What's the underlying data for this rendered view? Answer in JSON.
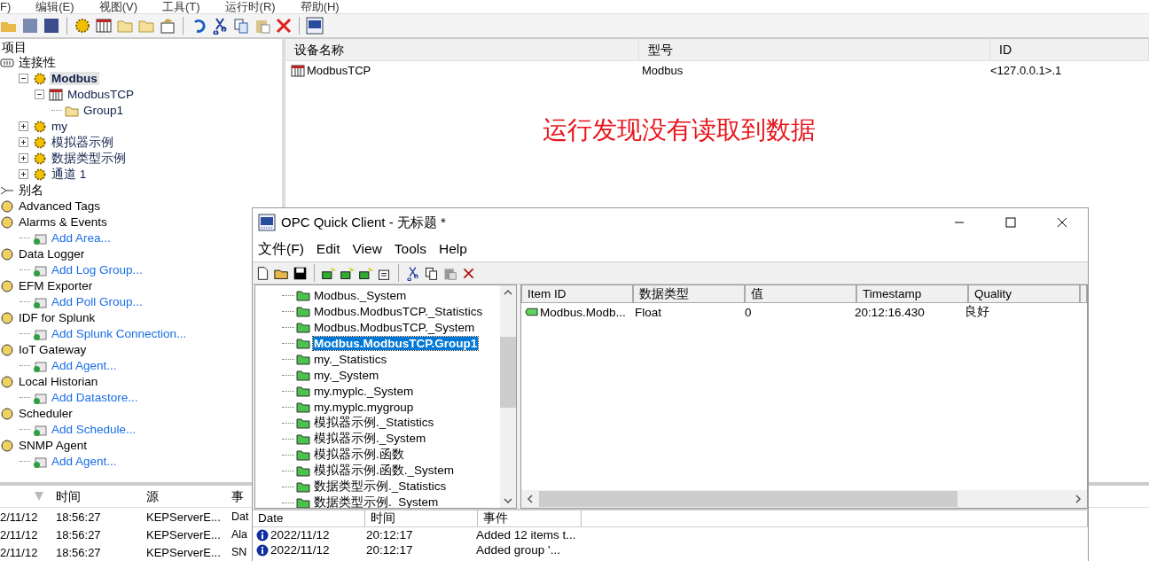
{
  "menu": [
    "F)",
    "编辑(E)",
    "视图(V)",
    "工具(T)",
    "运行时(R)",
    "帮助(H)"
  ],
  "tree_header": "项目",
  "tree": [
    {
      "label": "连接性",
      "kind": "connectivity",
      "children": [
        {
          "label": "Modbus",
          "kind": "channel",
          "selected": true,
          "expanded": true,
          "children": [
            {
              "label": "ModbusTCP",
              "kind": "device",
              "selected": false,
              "expanded": true,
              "children": [
                {
                  "label": "Group1",
                  "kind": "group",
                  "selected": false
                }
              ]
            }
          ]
        },
        {
          "label": "my",
          "kind": "channel",
          "selected": false,
          "expanded": false
        },
        {
          "label": "模拟器示例",
          "kind": "channel",
          "selected": false,
          "expanded": false
        },
        {
          "label": "数据类型示例",
          "kind": "channel",
          "selected": false,
          "expanded": false
        },
        {
          "label": "通道 1",
          "kind": "channel",
          "selected": false,
          "expanded": false
        }
      ]
    },
    {
      "label": "别名",
      "kind": "alias"
    },
    {
      "label": "Advanced Tags",
      "kind": "plugin"
    },
    {
      "label": "Alarms & Events",
      "kind": "plugin",
      "children": [
        {
          "label": "Add Area...",
          "kind": "action"
        }
      ]
    },
    {
      "label": "Data Logger",
      "kind": "plugin",
      "children": [
        {
          "label": "Add Log Group...",
          "kind": "action"
        }
      ]
    },
    {
      "label": "EFM Exporter",
      "kind": "plugin",
      "children": [
        {
          "label": "Add Poll Group...",
          "kind": "action"
        }
      ]
    },
    {
      "label": "IDF for Splunk",
      "kind": "plugin",
      "children": [
        {
          "label": "Add Splunk Connection...",
          "kind": "action"
        }
      ]
    },
    {
      "label": "IoT Gateway",
      "kind": "plugin",
      "children": [
        {
          "label": "Add Agent...",
          "kind": "action"
        }
      ]
    },
    {
      "label": "Local Historian",
      "kind": "plugin",
      "children": [
        {
          "label": "Add Datastore...",
          "kind": "action"
        }
      ]
    },
    {
      "label": "Scheduler",
      "kind": "plugin",
      "children": [
        {
          "label": "Add Schedule...",
          "kind": "action"
        }
      ]
    },
    {
      "label": "SNMP Agent",
      "kind": "plugin",
      "children": [
        {
          "label": "Add Agent...",
          "kind": "action"
        }
      ]
    }
  ],
  "device_table": {
    "columns": [
      "设备名称",
      "型号",
      "ID"
    ],
    "rows": [
      [
        "ModbusTCP",
        "Modbus",
        "<127.0.0.1>.1"
      ]
    ]
  },
  "annotation": "运行发现没有读取到数据",
  "event_log": {
    "columns": [
      "",
      "时间",
      "源",
      "事"
    ],
    "rows": [
      [
        "2/11/12",
        "18:56:27",
        "KEPServerE...",
        "Dat"
      ],
      [
        "2/11/12",
        "18:56:27",
        "KEPServerE...",
        "Ala"
      ],
      [
        "2/11/12",
        "18:56:27",
        "KEPServerE...",
        "SN"
      ]
    ]
  },
  "client": {
    "title": "OPC Quick Client - 无标题 *",
    "menu": [
      "文件(F)",
      "Edit",
      "View",
      "Tools",
      "Help"
    ],
    "groups": [
      {
        "label": "Modbus._System",
        "selected": false
      },
      {
        "label": "Modbus.ModbusTCP._Statistics",
        "selected": false
      },
      {
        "label": "Modbus.ModbusTCP._System",
        "selected": false
      },
      {
        "label": "Modbus.ModbusTCP.Group1",
        "selected": true
      },
      {
        "label": "my._Statistics",
        "selected": false
      },
      {
        "label": "my._System",
        "selected": false
      },
      {
        "label": "my.myplc._System",
        "selected": false
      },
      {
        "label": "my.myplc.mygroup",
        "selected": false
      },
      {
        "label": "模拟器示例._Statistics",
        "selected": false
      },
      {
        "label": "模拟器示例._System",
        "selected": false
      },
      {
        "label": "模拟器示例.函数",
        "selected": false
      },
      {
        "label": "模拟器示例.函数._System",
        "selected": false
      },
      {
        "label": "数据类型示例._Statistics",
        "selected": false
      },
      {
        "label": "数据类型示例._System",
        "selected": false
      }
    ],
    "items": {
      "columns": [
        "Item ID",
        "数据类型",
        "值",
        "Timestamp",
        "Quality"
      ],
      "rows": [
        [
          "Modbus.Modb...",
          "Float",
          "0",
          "20:12:16.430",
          "良好"
        ]
      ]
    },
    "log": {
      "columns": [
        "Date",
        "时间",
        "事件"
      ],
      "rows": [
        [
          "2022/11/12",
          "20:12:17",
          "Added 12 items t..."
        ],
        [
          "2022/11/12",
          "20:12:17",
          "Added group '..."
        ]
      ]
    }
  }
}
